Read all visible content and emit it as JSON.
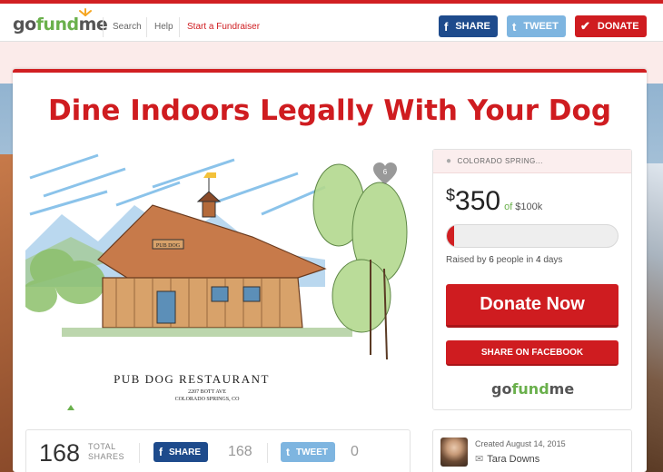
{
  "header": {
    "logo_part1": "go",
    "logo_part2": "fund",
    "logo_part3": "me",
    "nav": {
      "search": "Search",
      "help": "Help",
      "start": "Start a Fundraiser"
    },
    "share_label": "SHARE",
    "tweet_label": "TWEET",
    "donate_label": "DONATE",
    "brand_red": "#d11f22",
    "facebook_blue": "#1e4b8c",
    "twitter_blue": "#7eb5e0",
    "logo_green": "#6ab04c"
  },
  "campaign": {
    "title": "Dine Indoors Legally With Your Dog",
    "image_caption": "PUB DOG RESTAURANT",
    "image_address_line1": "2207 BOTT AVE",
    "image_address_line2": "COLORADO SPRINGS, CO",
    "image_sign": "PUB DOG",
    "photo_count": "6"
  },
  "sidebar": {
    "location": "COLORADO SPRING...",
    "currency": "$",
    "amount": "350",
    "of_text": "of",
    "goal": "$100k",
    "progress_fraction": 0.0035,
    "raised_prefix": "Raised by",
    "people_count": "6",
    "people_word": "people in",
    "days_count": "4",
    "days_word": "days",
    "donate_now": "Donate Now",
    "share_facebook": "SHARE ON FACEBOOK"
  },
  "shares": {
    "total": "168",
    "total_label_1": "TOTAL",
    "total_label_2": "SHARES",
    "fb_label": "SHARE",
    "fb_count": "168",
    "tweet_label": "TWEET",
    "tweet_count": "0"
  },
  "creator": {
    "created": "Created August 14, 2015",
    "name": "Tara Downs"
  }
}
